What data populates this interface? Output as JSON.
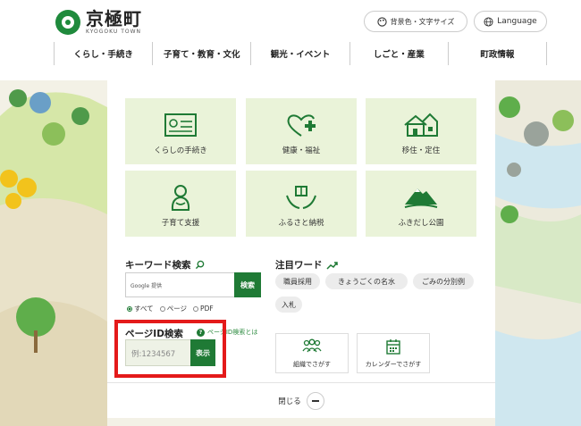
{
  "header": {
    "logo_jp": "京極町",
    "logo_en": "KYOGOKU TOWN",
    "color_button_label": "背景色・文字サイズ",
    "language_button_label": "Language"
  },
  "nav": {
    "items": [
      "くらし・手続き",
      "子育て・教育・文化",
      "観光・イベント",
      "しごと・産業",
      "町政情報"
    ]
  },
  "tiles": [
    {
      "label": "くらしの手続き",
      "icon": "id-card-icon"
    },
    {
      "label": "健康・福祉",
      "icon": "heart-plus-icon"
    },
    {
      "label": "移住・定住",
      "icon": "house-icon"
    },
    {
      "label": "子育て支援",
      "icon": "baby-icon"
    },
    {
      "label": "ふるさと納税",
      "icon": "hands-gift-icon"
    },
    {
      "label": "ふきだし公園",
      "icon": "mountain-icon"
    }
  ],
  "keyword": {
    "title": "キーワード検索",
    "placeholder": "Google 提供",
    "button": "検索",
    "radios": [
      "すべて",
      "ページ",
      "PDF"
    ],
    "selected": "すべて"
  },
  "trending": {
    "title": "注目ワード",
    "tags": [
      "職員採用",
      "きょうごくの名水",
      "ごみの分別例",
      "入札"
    ]
  },
  "page_id": {
    "title": "ページID検索",
    "help": "ページID検索とは",
    "placeholder": "例:1234567",
    "button": "表示"
  },
  "cards": [
    {
      "label": "組織でさがす",
      "icon": "people-icon"
    },
    {
      "label": "カレンダーでさがす",
      "icon": "calendar-icon"
    }
  ],
  "close_label": "閉じる",
  "colors": {
    "accent": "#1f7a35",
    "tile_bg": "#eaf3d9",
    "highlight": "#e41a1a"
  }
}
